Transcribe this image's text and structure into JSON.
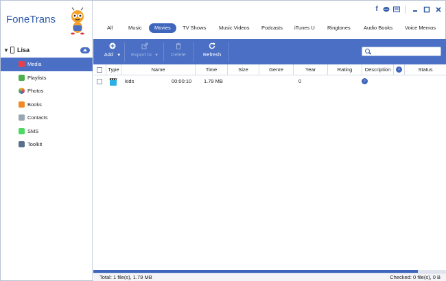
{
  "app": {
    "title": "FoneTrans"
  },
  "device": {
    "name": "Lisa"
  },
  "sidebar": {
    "items": [
      {
        "label": "Media",
        "icon": "music-icon",
        "color": "#e8404a",
        "active": true
      },
      {
        "label": "Playlists",
        "icon": "playlist-icon",
        "color": "#4caf50",
        "active": false
      },
      {
        "label": "Photos",
        "icon": "photos-icon",
        "color": "#f5a623",
        "active": false
      },
      {
        "label": "Books",
        "icon": "books-icon",
        "color": "#f08a24",
        "active": false
      },
      {
        "label": "Contacts",
        "icon": "contacts-icon",
        "color": "#7a8a99",
        "active": false
      },
      {
        "label": "SMS",
        "icon": "sms-icon",
        "color": "#4cd964",
        "active": false
      },
      {
        "label": "Toolkit",
        "icon": "toolkit-icon",
        "color": "#5b6f8a",
        "active": false
      }
    ]
  },
  "tabs": [
    "All",
    "Music",
    "Movies",
    "TV Shows",
    "Music Videos",
    "Podcasts",
    "iTunes U",
    "Ringtones",
    "Audio Books",
    "Voice Memos"
  ],
  "active_tab": "Movies",
  "toolbar": {
    "add": "Add",
    "export": "Export to",
    "delete": "Delete",
    "refresh": "Refresh",
    "search_placeholder": ""
  },
  "table": {
    "columns": [
      "Type",
      "Name",
      "Time",
      "Size",
      "Genre",
      "Year",
      "Rating",
      "Description",
      "Status"
    ],
    "rows": [
      {
        "name": "kids",
        "time": "00:00:10",
        "size": "1.79 MB",
        "genre": "",
        "year": "",
        "rating": "0",
        "description": "",
        "status": ""
      }
    ]
  },
  "progress": 0.92,
  "status": {
    "left": "Total: 1 file(s), 1.79 MB",
    "right": "Checked: 0 file(s), 0 B"
  },
  "colors": {
    "accent": "#4a6fc4",
    "brand": "#2d5aa8"
  }
}
